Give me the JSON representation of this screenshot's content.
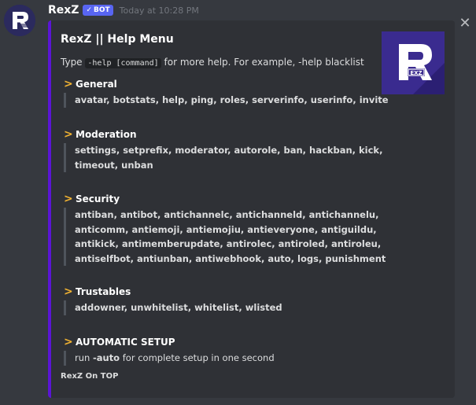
{
  "author": {
    "name": "RexZ",
    "badge": "BOT",
    "timestamp": "Today at 10:28 PM"
  },
  "embed": {
    "accent_color": "#5b15d6",
    "title": "RexZ || Help Menu",
    "description": {
      "prefix": "Type ",
      "code": "-help [command]",
      "suffix": " for more help. For example, -help blacklist"
    },
    "fields": [
      {
        "name": "General",
        "lines": [
          "avatar, botstats, help, ping, roles, serverinfo, userinfo, invite"
        ]
      },
      {
        "name": "Moderation",
        "lines": [
          "settings, setprefix, moderator, autorole, ban, hackban, kick,",
          "timeout, unban"
        ]
      },
      {
        "name": "Security",
        "lines": [
          "antiban, antibot, antichannelc, antichanneld, antichannelu,",
          "anticomm, antiemoji, antiemojiu, antieveryone, antiguildu,",
          "antikick, antimemberupdate, antirolec, antiroled, antiroleu,",
          "antiselfbot, antiunban, antiwebhook, auto, logs, punishment"
        ]
      },
      {
        "name": "Trustables",
        "lines": [
          "addowner, unwhitelist, whitelist, wlisted"
        ]
      },
      {
        "name": " AUTOMATIC SETUP",
        "run_prefix": "run ",
        "run_command": "-auto",
        "run_suffix": " for complete setup in one second"
      }
    ],
    "footer": "RexZ On TOP"
  },
  "icons": {
    "close": "close-icon",
    "chevron": "chevron-right-icon",
    "check": "check-icon"
  },
  "colors": {
    "background": "#36393f",
    "embed_bg": "#2f3136",
    "bot_badge": "#5865f2",
    "chevron": "#f0b232"
  }
}
